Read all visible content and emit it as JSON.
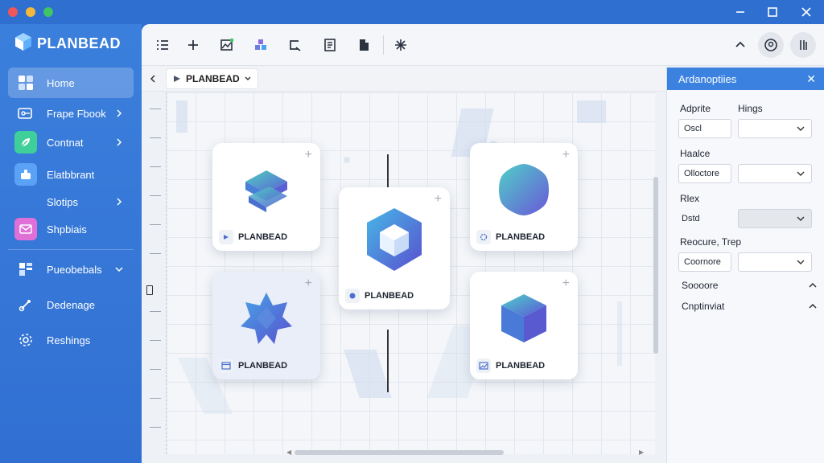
{
  "app": {
    "brand": "PLANBEAD"
  },
  "sidebar": {
    "items": [
      {
        "label": "Home",
        "icon": "grid-icon",
        "active": true,
        "chevron": false
      },
      {
        "label": "Frape Fbook",
        "icon": "folder-link-icon",
        "active": false,
        "chevron": true
      },
      {
        "label": "Contnat",
        "icon": "leaf-icon",
        "active": false,
        "chevron": true
      },
      {
        "label": "Elatbbrant",
        "icon": "component-icon",
        "active": false,
        "chevron": false
      },
      {
        "label": "Slotips",
        "icon": "none",
        "active": false,
        "chevron": true
      },
      {
        "label": "Shpbiais",
        "icon": "mail-icon",
        "active": false,
        "chevron": false
      },
      {
        "label": "Pueobebals",
        "icon": "layout-icon",
        "active": false,
        "chevron": true
      },
      {
        "label": "Dedenage",
        "icon": "brush-icon",
        "active": false,
        "chevron": false
      },
      {
        "label": "Reshings",
        "icon": "gear-icon",
        "active": false,
        "chevron": false
      }
    ]
  },
  "breadcrumb": {
    "tab_label": "PLANBEAD"
  },
  "cards": [
    {
      "label": "PLANBEAD",
      "shape": "stacked-slabs-shape",
      "foot_icon": "play-icon",
      "tinted": false
    },
    {
      "label": "PLANBEAD",
      "shape": "hexagon-cube-shape",
      "foot_icon": "record-icon",
      "tinted": false
    },
    {
      "label": "PLANBEAD",
      "shape": "rounded-hexagon-shape",
      "foot_icon": "gear-icon",
      "tinted": false
    },
    {
      "label": "PLANBEAD",
      "shape": "star-polyhedron-shape",
      "foot_icon": "window-icon",
      "tinted": true
    },
    {
      "label": "PLANBEAD",
      "shape": "cube-shape",
      "foot_icon": "image-icon",
      "tinted": false
    }
  ],
  "panel": {
    "title": "Ardanoptiies",
    "labels": {
      "adprite": "Adprite",
      "hings": "Hings",
      "haalce": "Haalce",
      "rlex": "Rlex",
      "reocure": "Reocure, Trep",
      "soooore": "Soooore",
      "cnptinviat": "Cnptinviat"
    },
    "inputs": {
      "oscl": "Oscl",
      "olloctore": "Olloctore",
      "dstd": "Dstd",
      "coornore": "Coornore"
    }
  },
  "colors": {
    "sidebar": "#3b7fdc",
    "accent": "#3b82e0",
    "canvas": "#f4f6f9"
  }
}
